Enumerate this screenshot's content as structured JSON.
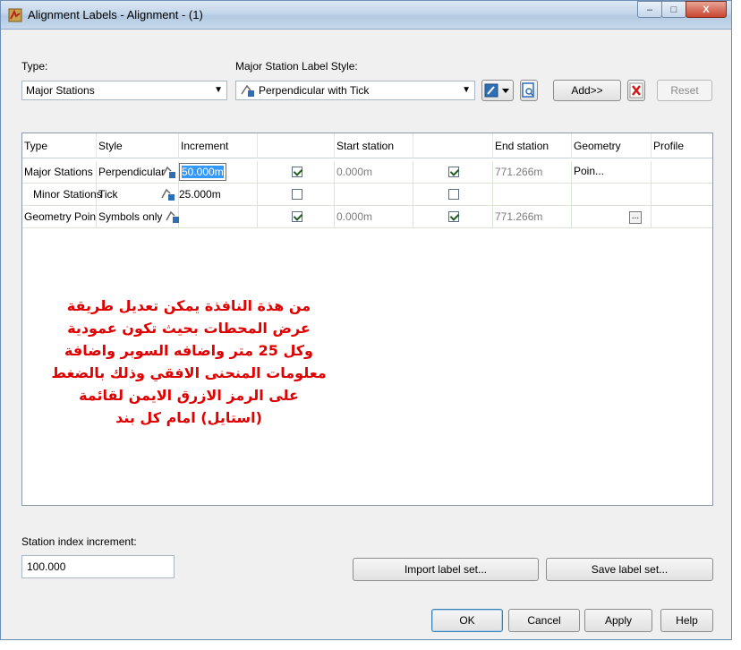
{
  "window": {
    "title": "Alignment Labels - Alignment - (1)"
  },
  "type_label": "Type:",
  "type_value": "Major Stations",
  "style_label": "Major Station Label Style:",
  "style_value": "Perpendicular with Tick",
  "buttons": {
    "add": "Add>>",
    "reset": "Reset",
    "import": "Import label set...",
    "save": "Save label set...",
    "ok": "OK",
    "cancel": "Cancel",
    "apply": "Apply",
    "help": "Help"
  },
  "table": {
    "headers": [
      "Type",
      "Style",
      "Increment",
      "Start station",
      "End station",
      "Geometry Poin...",
      "Profile"
    ],
    "rows": [
      {
        "type": "Major Stations",
        "style": "Perpendicular",
        "increment": "50.000m",
        "start_checked": true,
        "start": "0.000m",
        "end_checked": true,
        "end": "771.266m"
      },
      {
        "type": "Minor Stations",
        "style": "Tick",
        "increment": "25.000m",
        "start_checked": false,
        "start": "",
        "end_checked": false,
        "end": ""
      },
      {
        "type": "Geometry Points",
        "style": "Symbols only",
        "increment": "",
        "start_checked": true,
        "start": "0.000m",
        "end_checked": true,
        "end": "771.266m"
      }
    ]
  },
  "annotation_lines": [
    "من هذة النافذة يمكن تعديل طريقة",
    "عرض المحطات بحيث تكون عمودية",
    "وكل 25 متر واضافه السوبر واضافة",
    "معلومات المنحنى الافقي وذلك بالضغط",
    "على الرمز الازرق الايمن لقائمة",
    "(استايل) امام كل بند"
  ],
  "station_index": {
    "label": "Station index increment:",
    "value": "100.000"
  },
  "colors": {
    "annotation": "#e00000",
    "selection": "#3399ff",
    "check": "#1f5e1f"
  }
}
